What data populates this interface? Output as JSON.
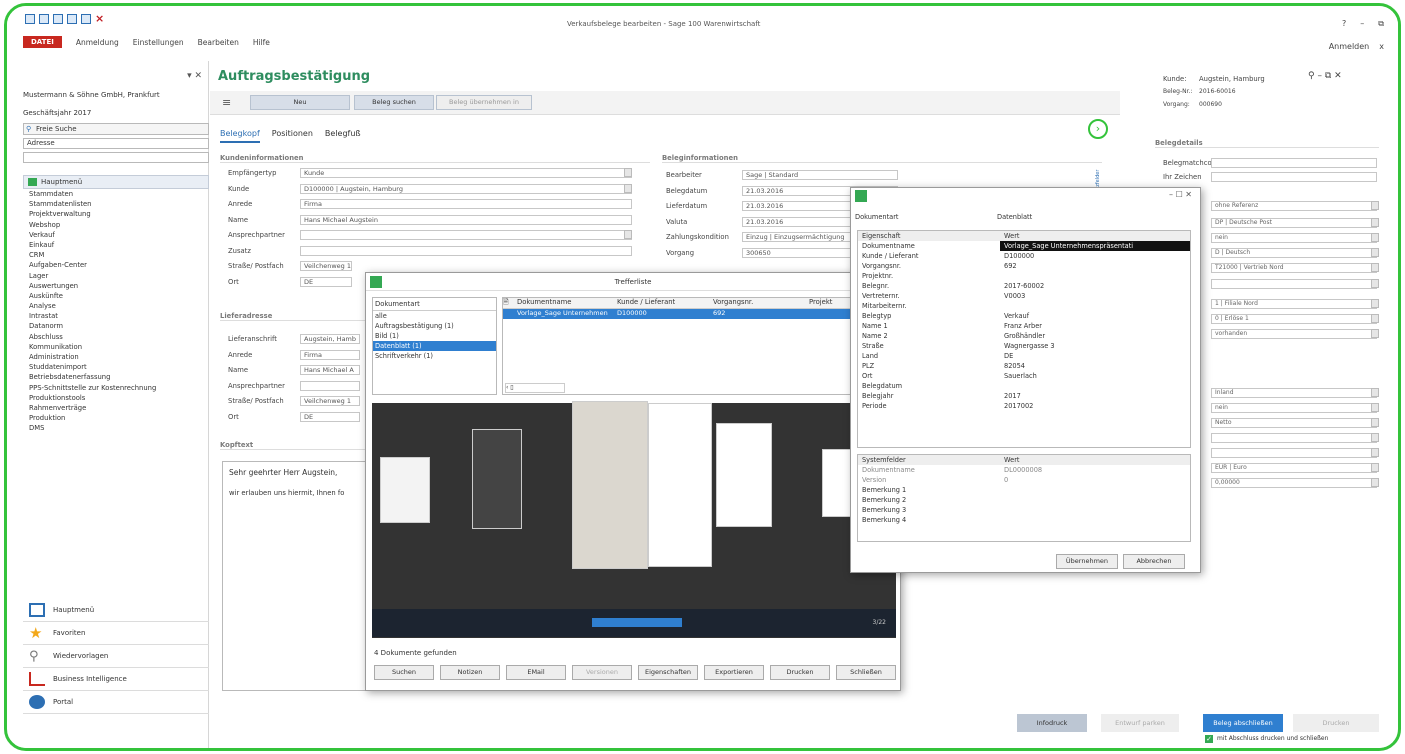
{
  "window": {
    "title": "Verkaufsbelege bearbeiten - Sage 100 Warenwirtschaft",
    "help": "?",
    "minimize": "–",
    "restore": "⧉"
  },
  "menu": {
    "file": "DATEI",
    "items": [
      "Anmeldung",
      "Einstellungen",
      "Bearbeiten",
      "Hilfe"
    ],
    "login": "Anmelden",
    "close": "x"
  },
  "left": {
    "company": "Mustermann & Söhne GmbH, Prankfurt",
    "year": "Geschäftsjahr 2017",
    "search_label": "Freie Suche",
    "search_type": "Adresse",
    "nav_head": "Hauptmenü",
    "tree": [
      "Stammdaten",
      "Stammdatenlisten",
      "Projektverwaltung",
      "Webshop",
      "Verkauf",
      "Einkauf",
      "CRM",
      "Aufgaben-Center",
      "Lager",
      "Auswertungen",
      "Auskünfte",
      "Analyse",
      "Intrastat",
      "Datanorm",
      "Abschluss",
      "Kommunikation",
      "Administration",
      "Studdatenimport",
      "Betriebsdatenerfassung",
      "PPS-Schnittstelle zur Kostenrechnung",
      "Produktionstools",
      "Rahmenverträge",
      "Produktion",
      "DMS"
    ],
    "bottom": [
      "Hauptmenü",
      "Favoriten",
      "Wiedervorlagen",
      "Business Intelligence",
      "Portal"
    ]
  },
  "main": {
    "title": "Auftragsbestätigung",
    "new": "Neu",
    "find": "Beleg suchen",
    "take": "Beleg übernehmen in",
    "tabs": [
      "Belegkopf",
      "Positionen",
      "Belegfuß"
    ],
    "sect_customer": "Kundeninformationen",
    "sect_doc": "Beleginformationen",
    "sect_delivery": "Lieferadresse",
    "sect_head": "Kopftext",
    "labels": [
      "Empfängertyp",
      "Kunde",
      "Anrede",
      "Name",
      "Ansprechpartner",
      "Zusatz",
      "Straße/ Postfach",
      "Ort"
    ],
    "values": [
      "Kunde",
      "D100000 | Augstein, Hamburg",
      "Firma",
      "Hans Michael Augstein",
      "",
      "",
      "Veilchenweg 1",
      "DE"
    ],
    "doc_labels": [
      "Bearbeiter",
      "Belegdatum",
      "Lieferdatum",
      "Valuta",
      "Zahlungskondition",
      "Vorgang"
    ],
    "doc_values": [
      "Sage | Standard",
      "21.03.2016",
      "21.03.2016",
      "21.03.2016",
      "Einzug | Einzugsermächtigung",
      "300650"
    ],
    "del_labels": [
      "Lieferanschrift",
      "Anrede",
      "Name",
      "Ansprechpartner",
      "Straße/ Postfach",
      "Ort"
    ],
    "del_values": [
      "Augstein, Hamb",
      "Firma",
      "Hans Michael A",
      "",
      "Veilchenweg 1",
      "DE"
    ],
    "text1": "Sehr geehrter Herr Augstein,",
    "text2": "wir erlauben uns hiermit, Ihnen fo",
    "expand": "Zusatzfelder"
  },
  "right": {
    "customer_lbl": "Kunde:",
    "customer": "Augstein, Hamburg",
    "no_lbl": "Beleg-Nr.:",
    "no": "2016-60016",
    "proc_lbl": "Vorgang:",
    "proc": "000690",
    "sect": "Belegdetails",
    "l1": "Belegmatchcode",
    "l2": "Ihr Zeichen",
    "vals": [
      "ohne Referenz",
      "DP | Deutsche Post",
      "nein",
      "D | Deutsch",
      "T21000 | Vertrieb Nord",
      "",
      "1 | Filiale Nord",
      "0 | Erlöse 1",
      "vorhanden",
      "Inland",
      "nein",
      "Netto",
      "",
      "",
      "EUR | Euro",
      "0,00000"
    ]
  },
  "finder": {
    "title": "Trefferliste",
    "col_doctype": "Dokumentart",
    "types": [
      "alle",
      "Auftragsbestätigung (1)",
      "Bild (1)",
      "Datenblatt (1)",
      "Schriftverkehr (1)"
    ],
    "cols": [
      "Dokumentname",
      "Kunde / Lieferant",
      "Vorgangsnr.",
      "Projekt"
    ],
    "row": [
      "Vorlage_Sage Unternehmen",
      "D100000",
      "692"
    ],
    "found": "4 Dokumente gefunden",
    "page": "3/22",
    "buttons": [
      "Suchen",
      "Notizen",
      "EMail",
      "Versionen",
      "Eigenschaften",
      "Exportieren",
      "Drucken",
      "Schließen"
    ]
  },
  "props": {
    "doctype_lbl": "Dokumentart",
    "doctype": "Datenblatt",
    "col1": "Eigenschaft",
    "col2": "Wert",
    "rows": [
      [
        "Dokumentname",
        "Vorlage_Sage Unternehmenspräsentati"
      ],
      [
        "Kunde / Lieferant",
        "D100000"
      ],
      [
        "Vorgangsnr.",
        "692"
      ],
      [
        "Projektnr.",
        ""
      ],
      [
        "Belegnr.",
        "2017-60002"
      ],
      [
        "Vertreternr.",
        "V0003"
      ],
      [
        "Mitarbeiternr.",
        ""
      ],
      [
        "Belegtyp",
        "Verkauf"
      ],
      [
        "Name 1",
        "Franz Arber"
      ],
      [
        "Name 2",
        "Großhändler"
      ],
      [
        "Straße",
        "Wagnergasse 3"
      ],
      [
        "Land",
        "DE"
      ],
      [
        "PLZ",
        "82054"
      ],
      [
        "Ort",
        "Sauerlach"
      ],
      [
        "Belegdatum",
        ""
      ],
      [
        "Belegjahr",
        "2017"
      ],
      [
        "Periode",
        "2017002"
      ]
    ],
    "sys_col1": "Systemfelder",
    "sys_col2": "Wert",
    "sys": [
      [
        "Dokumentname",
        "DL0000008"
      ],
      [
        "Version",
        "0"
      ],
      [
        "Bemerkung 1",
        ""
      ],
      [
        "Bemerkung 2",
        ""
      ],
      [
        "Bemerkung 3",
        ""
      ],
      [
        "Bemerkung 4",
        ""
      ]
    ],
    "ok": "Übernehmen",
    "cancel": "Abbrechen"
  },
  "bottom": {
    "info": "Infodruck",
    "draft": "Entwurf parken",
    "close": "Beleg abschließen",
    "print": "Drucken",
    "check": "mit Abschluss drucken und schließen"
  },
  "colors": {
    "accent": "#2e8d5f",
    "frame": "#34c33b",
    "blue": "#2f7fd0"
  }
}
